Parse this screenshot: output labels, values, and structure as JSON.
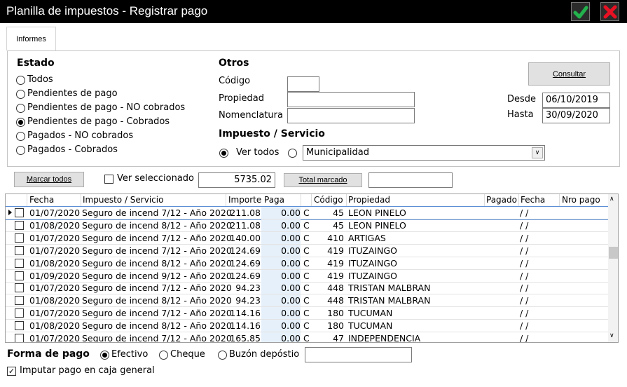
{
  "window": {
    "title": "Planilla de impuestos - Registrar pago"
  },
  "tab": {
    "label": "Informes"
  },
  "estado": {
    "header": "Estado",
    "options": [
      {
        "label": "Todos",
        "selected": false
      },
      {
        "label": "Pendientes de pago",
        "selected": false
      },
      {
        "label": "Pendientes de pago - NO cobrados",
        "selected": false
      },
      {
        "label": "Pendientes de pago - Cobrados",
        "selected": true
      },
      {
        "label": "Pagados - NO cobrados",
        "selected": false
      },
      {
        "label": "Pagados - Cobrados",
        "selected": false
      }
    ]
  },
  "otros": {
    "header": "Otros",
    "codigo_label": "Código",
    "codigo_value": "",
    "propiedad_label": "Propiedad",
    "propiedad_value": "",
    "nomenclatura_label": "Nomenclatura",
    "nomenclatura_value": ""
  },
  "impuesto": {
    "header": "Impuesto / Servicio",
    "ver_todos_label": "Ver todos",
    "ver_todos_selected": true,
    "select_value": "Municipalidad"
  },
  "consultar": {
    "label": "Consultar"
  },
  "desde": {
    "label": "Desde",
    "value": "06/10/2019"
  },
  "hasta": {
    "label": "Hasta",
    "value": "30/09/2020"
  },
  "toolbar": {
    "marcar_todos": "Marcar todos",
    "ver_seleccionado": "Ver seleccionado",
    "total_value": "5735.02",
    "total_marcado": "Total marcado",
    "total_marcado_value": ""
  },
  "grid": {
    "columns": [
      "Fecha",
      "Impuesto / Servicio",
      "Importe",
      "Paga",
      "Código",
      "Propiedad",
      "Pagado",
      "Fecha",
      "Nro pago"
    ],
    "rows": [
      {
        "fecha": "01/07/2020",
        "impuesto": "Seguro de incend 7/12 - Año 2020",
        "importe": "211.08",
        "paga": "0.00",
        "c": "C",
        "codigo": "45",
        "propiedad": "LEON PINELO",
        "pfecha": "/ /"
      },
      {
        "fecha": "01/08/2020",
        "impuesto": "Seguro de incend 8/12 - Año 2020",
        "importe": "211.08",
        "paga": "0.00",
        "c": "C",
        "codigo": "45",
        "propiedad": "LEON PINELO",
        "pfecha": "/ /"
      },
      {
        "fecha": "01/07/2020",
        "impuesto": "Seguro de incend 7/12 - Año 2020",
        "importe": "140.00",
        "paga": "0.00",
        "c": "C",
        "codigo": "410",
        "propiedad": "ARTIGAS",
        "pfecha": "/ /"
      },
      {
        "fecha": "01/07/2020",
        "impuesto": "Seguro de incend 7/12 - Año 2020",
        "importe": "124.69",
        "paga": "0.00",
        "c": "C",
        "codigo": "419",
        "propiedad": "ITUZAINGO",
        "pfecha": "/ /"
      },
      {
        "fecha": "01/08/2020",
        "impuesto": "Seguro de incend 8/12 - Año 2020",
        "importe": "124.69",
        "paga": "0.00",
        "c": "C",
        "codigo": "419",
        "propiedad": "ITUZAINGO",
        "pfecha": "/ /"
      },
      {
        "fecha": "01/09/2020",
        "impuesto": "Seguro de incend 9/12 - Año 2020",
        "importe": "124.69",
        "paga": "0.00",
        "c": "C",
        "codigo": "419",
        "propiedad": "ITUZAINGO",
        "pfecha": "/ /"
      },
      {
        "fecha": "01/07/2020",
        "impuesto": "Seguro de incend 7/12 - Año 2020",
        "importe": "94.23",
        "paga": "0.00",
        "c": "C",
        "codigo": "448",
        "propiedad": "TRISTAN MALBRAN",
        "pfecha": "/ /"
      },
      {
        "fecha": "01/08/2020",
        "impuesto": "Seguro de incend 8/12 - Año 2020",
        "importe": "94.23",
        "paga": "0.00",
        "c": "C",
        "codigo": "448",
        "propiedad": "TRISTAN MALBRAN",
        "pfecha": "/ /"
      },
      {
        "fecha": "01/07/2020",
        "impuesto": "Seguro de incend 7/12 - Año 2020",
        "importe": "114.16",
        "paga": "0.00",
        "c": "C",
        "codigo": "180",
        "propiedad": "TUCUMAN",
        "pfecha": "/ /"
      },
      {
        "fecha": "01/08/2020",
        "impuesto": "Seguro de incend 8/12 - Año 2020",
        "importe": "114.16",
        "paga": "0.00",
        "c": "C",
        "codigo": "180",
        "propiedad": "TUCUMAN",
        "pfecha": "/ /"
      },
      {
        "fecha": "01/07/2020",
        "impuesto": "Seguro de incend 7/12 - Año 2020",
        "importe": "165.85",
        "paga": "0.00",
        "c": "C",
        "codigo": "47",
        "propiedad": "INDEPENDENCIA",
        "pfecha": "/ /"
      }
    ]
  },
  "forma_pago": {
    "label": "Forma de pago",
    "options": [
      {
        "label": "Efectivo",
        "selected": true
      },
      {
        "label": "Cheque",
        "selected": false
      },
      {
        "label": "Buzón depóstio",
        "selected": false
      }
    ],
    "value": ""
  },
  "imputar": {
    "label": "Imputar pago en caja general",
    "checked": true
  },
  "icons": {
    "ok": "check-icon",
    "close": "close-icon"
  },
  "colors": {
    "titlebar": "#000000",
    "ok_green": "#22b14c",
    "close_red": "#e81123",
    "paga_bg": "#e6f0fa"
  }
}
